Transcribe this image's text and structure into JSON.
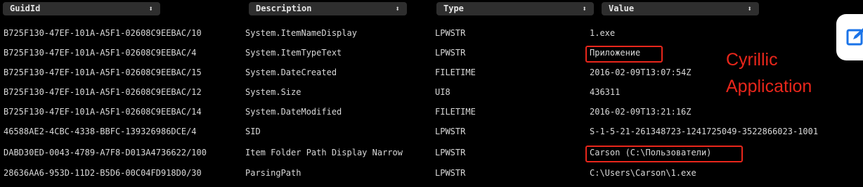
{
  "headers": {
    "guid": "GuidId",
    "description": "Description",
    "type": "Type",
    "value": "Value",
    "sort_glyph": "⬍"
  },
  "rows": [
    {
      "guid": "B725F130-47EF-101A-A5F1-02608C9EEBAC/10",
      "description": "System.ItemNameDisplay",
      "type": "LPWSTR",
      "value": "1.exe"
    },
    {
      "guid": "B725F130-47EF-101A-A5F1-02608C9EEBAC/4",
      "description": "System.ItemTypeText",
      "type": "LPWSTR",
      "value": "Приложение"
    },
    {
      "guid": "B725F130-47EF-101A-A5F1-02608C9EEBAC/15",
      "description": "System.DateCreated",
      "type": "FILETIME",
      "value": "2016-02-09T13:07:54Z"
    },
    {
      "guid": "B725F130-47EF-101A-A5F1-02608C9EEBAC/12",
      "description": "System.Size",
      "type": "UI8",
      "value": "436311"
    },
    {
      "guid": "B725F130-47EF-101A-A5F1-02608C9EEBAC/14",
      "description": "System.DateModified",
      "type": "FILETIME",
      "value": "2016-02-09T13:21:16Z"
    },
    {
      "guid": "46588AE2-4CBC-4338-BBFC-139326986DCE/4",
      "description": "SID",
      "type": "LPWSTR",
      "value": "S-1-5-21-261348723-1241725049-3522866023-1001"
    },
    {
      "guid": "DABD30ED-0043-4789-A7F8-D013A4736622/100",
      "description": "Item Folder Path Display Narrow",
      "type": "LPWSTR",
      "value": "Carson (C:\\Пользователи)"
    },
    {
      "guid": "28636AA6-953D-11D2-B5D6-00C04FD918D0/30",
      "description": "ParsingPath",
      "type": "LPWSTR",
      "value": "C:\\Users\\Carson\\1.exe"
    }
  ],
  "annotation": {
    "line1": "Cyrillic",
    "line2": "Application",
    "color": "#e8261b"
  },
  "colors": {
    "background": "#000000",
    "header_cell": "#2e2e2e",
    "text": "#d9d9d9"
  },
  "icons": {
    "corner_tool": "edit-icon"
  }
}
